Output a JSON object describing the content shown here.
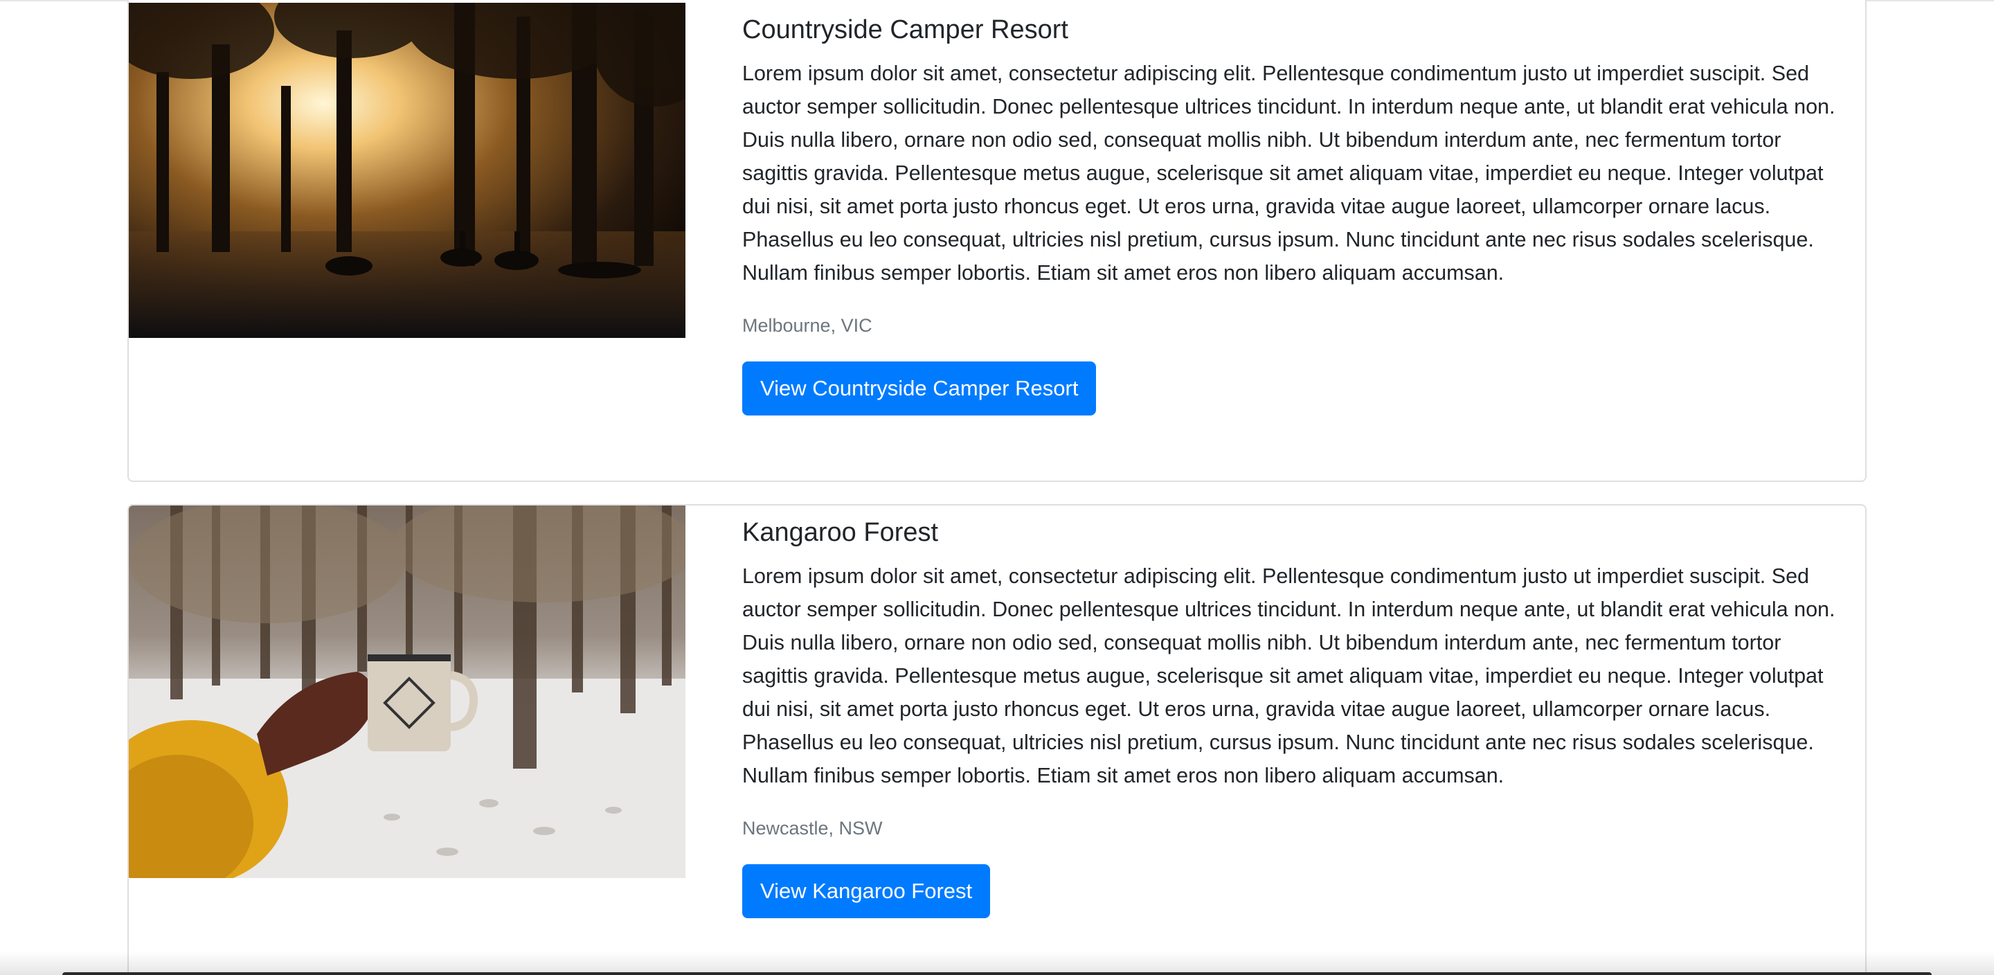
{
  "campgrounds": [
    {
      "title": "Countryside Camper Resort",
      "description": "Lorem ipsum dolor sit amet, consectetur adipiscing elit. Pellentesque condimentum justo ut imperdiet suscipit. Sed auctor semper sollicitudin. Donec pellentesque ultrices tincidunt. In interdum neque ante, ut blandit erat vehicula non. Duis nulla libero, ornare non odio sed, consequat mollis nibh. Ut bibendum interdum ante, nec fermentum tortor sagittis gravida. Pellentesque metus augue, scelerisque sit amet aliquam vitae, imperdiet eu neque. Integer volutpat dui nisi, sit amet porta justo rhoncus eget. Ut eros urna, gravida vitae augue laoreet, ullamcorper ornare lacus. Phasellus eu leo consequat, ultricies nisl pretium, cursus ipsum. Nunc tincidunt ante nec risus sodales scelerisque. Nullam finibus semper lobortis. Etiam sit amet eros non libero aliquam accumsan.",
      "location": "Melbourne, VIC",
      "button_label": "View Countryside Camper Resort"
    },
    {
      "title": "Kangaroo Forest",
      "description": "Lorem ipsum dolor sit amet, consectetur adipiscing elit. Pellentesque condimentum justo ut imperdiet suscipit. Sed auctor semper sollicitudin. Donec pellentesque ultrices tincidunt. In interdum neque ante, ut blandit erat vehicula non. Duis nulla libero, ornare non odio sed, consequat mollis nibh. Ut bibendum interdum ante, nec fermentum tortor sagittis gravida. Pellentesque metus augue, scelerisque sit amet aliquam vitae, imperdiet eu neque. Integer volutpat dui nisi, sit amet porta justo rhoncus eget. Ut eros urna, gravida vitae augue laoreet, ullamcorper ornare lacus. Phasellus eu leo consequat, ultricies nisl pretium, cursus ipsum. Nunc tincidunt ante nec risus sodales scelerisque. Nullam finibus semper lobortis. Etiam sit amet eros non libero aliquam accumsan.",
      "location": "Newcastle, NSW",
      "button_label": "View Kangaroo Forest"
    }
  ],
  "colors": {
    "primary": "#007bff",
    "muted_text": "#6c757d",
    "body_text": "#212529",
    "card_border": "rgba(0,0,0,0.125)"
  }
}
